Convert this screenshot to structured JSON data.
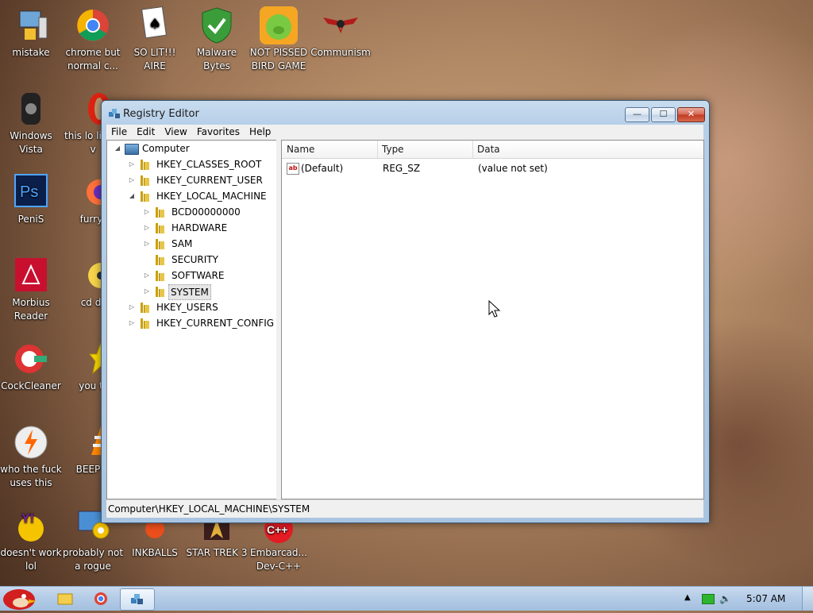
{
  "desktop": {
    "icons": [
      {
        "label": "mistake",
        "icon": "monitor-gadget-icon"
      },
      {
        "label": "chrome but normal c...",
        "icon": "chrome-icon"
      },
      {
        "label": "SO LIT!!! AIRE",
        "icon": "solitaire-icon"
      },
      {
        "label": "Malware Bytes",
        "icon": "shield-icon"
      },
      {
        "label": "NOT PISSED BIRD GAME",
        "icon": "pig-icon"
      },
      {
        "label": "Communism",
        "icon": "wing-emblem-icon"
      },
      {
        "label": "Windows Vista",
        "icon": "vista-can-icon"
      },
      {
        "label": "this lo like a v",
        "icon": "opera-icon"
      },
      {
        "label": "PeniS",
        "icon": "photoshop-icon"
      },
      {
        "label": "furryf",
        "icon": "firefox-icon"
      },
      {
        "label": "Morbius Reader",
        "icon": "pdf-reader-icon"
      },
      {
        "label": "cd dr",
        "icon": "cd-icon"
      },
      {
        "label": "CockCleaner",
        "icon": "ccleaner-icon"
      },
      {
        "label": "you tr",
        "icon": "star-icon"
      },
      {
        "label": "who the fuck uses this",
        "icon": "winamp-icon"
      },
      {
        "label": "BEEP B",
        "icon": "vlc-cone-icon"
      },
      {
        "label": "doesn't work lol",
        "icon": "yahoo-messenger-icon"
      },
      {
        "label": "probably not a rogue",
        "icon": "gear-monitor-icon"
      },
      {
        "label": "INKBALLS",
        "icon": "inkball-icon"
      },
      {
        "label": "STAR TREK 3",
        "icon": "star-trek-icon"
      },
      {
        "label": "Embarcad... Dev-C++",
        "icon": "devcpp-icon"
      }
    ]
  },
  "window": {
    "title": "Registry Editor",
    "menu": [
      "File",
      "Edit",
      "View",
      "Favorites",
      "Help"
    ],
    "tree": {
      "root": "Computer",
      "items": [
        {
          "label": "HKEY_CLASSES_ROOT",
          "expander": "▷"
        },
        {
          "label": "HKEY_CURRENT_USER",
          "expander": "▷"
        },
        {
          "label": "HKEY_LOCAL_MACHINE",
          "expander": "◢"
        },
        {
          "label": "BCD00000000",
          "expander": "▷"
        },
        {
          "label": "HARDWARE",
          "expander": "▷"
        },
        {
          "label": "SAM",
          "expander": "▷"
        },
        {
          "label": "SECURITY",
          "expander": ""
        },
        {
          "label": "SOFTWARE",
          "expander": "▷"
        },
        {
          "label": "SYSTEM",
          "expander": "▷"
        },
        {
          "label": "HKEY_USERS",
          "expander": "▷"
        },
        {
          "label": "HKEY_CURRENT_CONFIG",
          "expander": "▷"
        }
      ],
      "selected": "SYSTEM"
    },
    "list": {
      "columns": [
        "Name",
        "Type",
        "Data"
      ],
      "rows": [
        {
          "name": "(Default)",
          "type": "REG_SZ",
          "data": "(value not set)"
        }
      ]
    },
    "status_path": "Computer\\HKEY_LOCAL_MACHINE\\SYSTEM",
    "buttons": {
      "minimize": "—",
      "maximize": "☐",
      "close": "✕"
    }
  },
  "taskbar": {
    "clock": "5:07 AM"
  },
  "colors": {
    "accent": "#3c5a78",
    "taskbar": "#b3cbe6"
  }
}
